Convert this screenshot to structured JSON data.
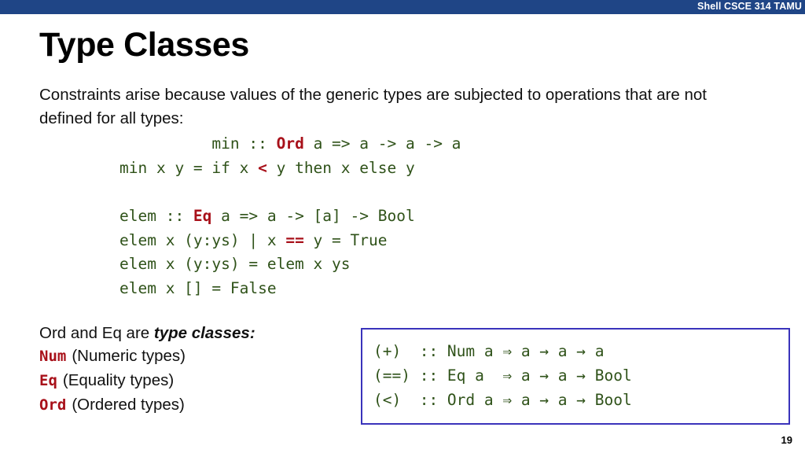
{
  "header": {
    "title": "Shell CSCE 314 TAMU",
    "bar_color": "#1f4586"
  },
  "slide": {
    "title": "Type Classes",
    "page_number": "19",
    "paragraph": "Constraints arise because values of the generic types are subjected to operations that are not defined for all types:"
  },
  "colors": {
    "code_green": "#2f5219",
    "keyword_red": "#a8111a",
    "box_border_blue": "#3a33bb",
    "header_blue": "#1f4586"
  },
  "code_min": {
    "line1_pre": "          min :: ",
    "line1_kw": "Ord",
    "line1_post": " a => a -> a -> a",
    "line2_pre": "min x y = if x ",
    "line2_kw": "<",
    "line2_post": " y then x else y"
  },
  "code_elem": {
    "line1_pre": "elem :: ",
    "line1_kw": "Eq",
    "line1_post": " a => a -> [a] -> Bool",
    "line2_pre": "elem x (y:ys) | x ",
    "line2_kw": "==",
    "line2_post": " y = True",
    "line3": "elem x (y:ys) = elem x ys",
    "line4": "elem x [] = False"
  },
  "summary": {
    "lead_plain": "Ord and Eq are ",
    "lead_emphasis": "type classes:",
    "rows": [
      {
        "class_name": "Num",
        "description": "(Numeric types)"
      },
      {
        "class_name": "Eq",
        "description": "(Equality types)"
      },
      {
        "class_name": "Ord",
        "description": "(Ordered types)"
      }
    ]
  },
  "signature_box": {
    "lines": [
      "(+)  :: Num a ⇒ a → a → a",
      "(==) :: Eq a  ⇒ a → a → Bool",
      "(<)  :: Ord a ⇒ a → a → Bool"
    ]
  }
}
